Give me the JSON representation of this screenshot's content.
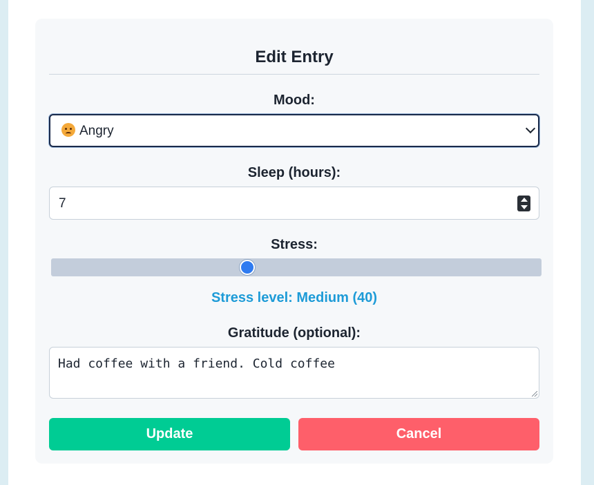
{
  "form": {
    "title": "Edit Entry",
    "mood": {
      "label": "Mood:",
      "selected": "Angry",
      "emoji_icon": "angry-face-icon"
    },
    "sleep": {
      "label": "Sleep (hours):",
      "value": "7"
    },
    "stress": {
      "label": "Stress:",
      "value": 40,
      "min": 0,
      "max": 100,
      "level_text": "Stress level: Medium (40)"
    },
    "gratitude": {
      "label": "Gratitude (optional):",
      "value": "Had coffee with a friend. Cold coffee"
    },
    "buttons": {
      "update_label": "Update",
      "cancel_label": "Cancel"
    }
  },
  "colors": {
    "update_button": "#00cc94",
    "cancel_button": "#fe5f6a",
    "stress_level_text": "#1d9bd7",
    "slider_thumb": "#2f7bf0",
    "page_background": "#dcedf3"
  }
}
